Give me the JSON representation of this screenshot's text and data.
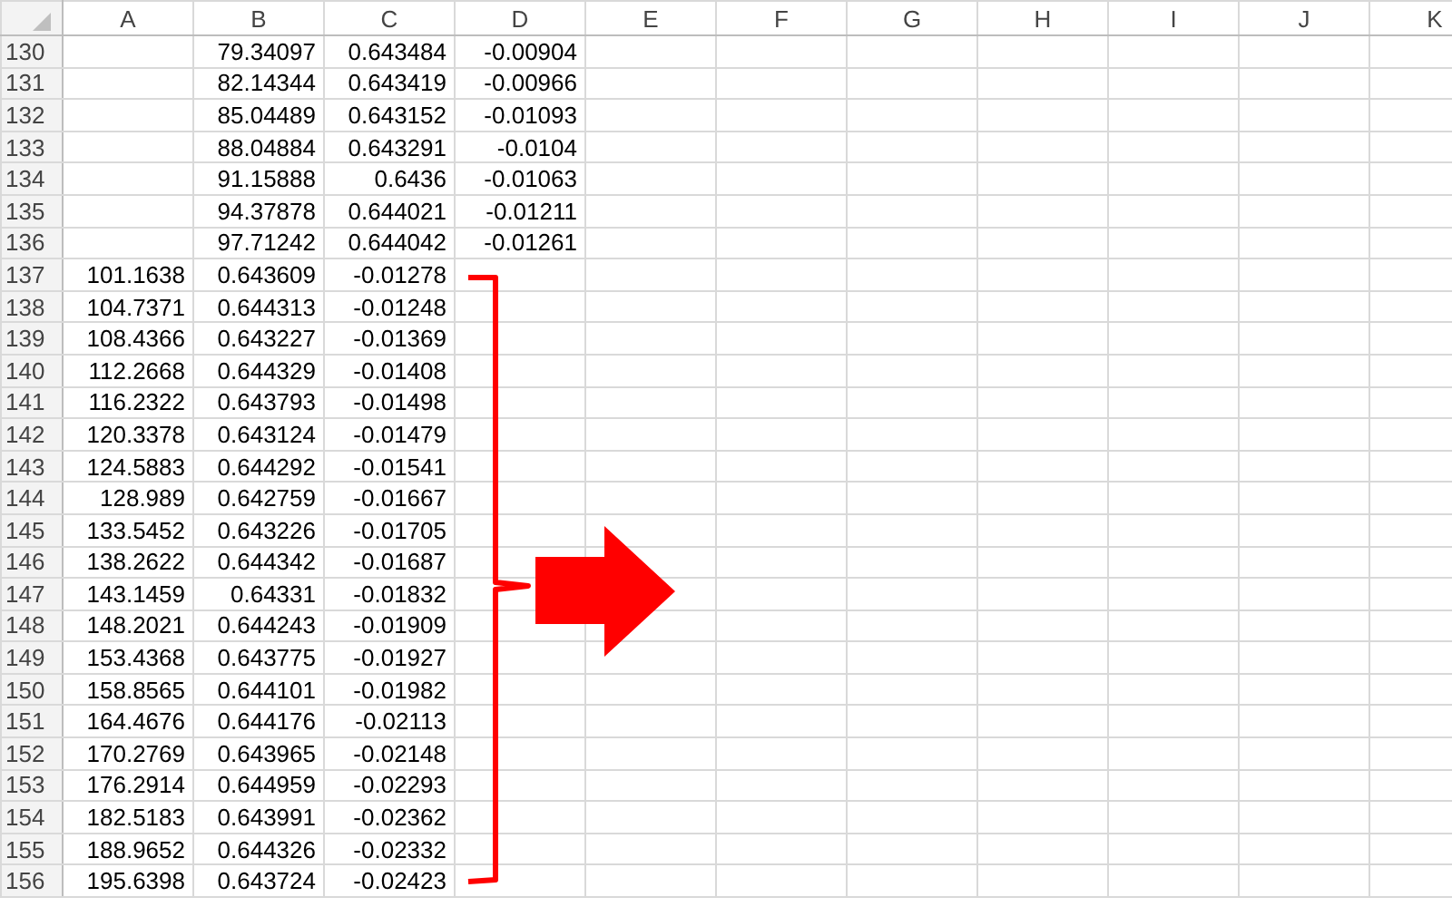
{
  "columns": [
    "A",
    "B",
    "C",
    "D",
    "E",
    "F",
    "G",
    "H",
    "I",
    "J",
    "K"
  ],
  "rows": [
    {
      "number": "130",
      "cells": [
        null,
        "79.34097",
        "0.643484",
        "-0.00904"
      ]
    },
    {
      "number": "131",
      "cells": [
        null,
        "82.14344",
        "0.643419",
        "-0.00966"
      ]
    },
    {
      "number": "132",
      "cells": [
        null,
        "85.04489",
        "0.643152",
        "-0.01093"
      ]
    },
    {
      "number": "133",
      "cells": [
        null,
        "88.04884",
        "0.643291",
        "-0.0104"
      ]
    },
    {
      "number": "134",
      "cells": [
        null,
        "91.15888",
        "0.6436",
        "-0.01063"
      ]
    },
    {
      "number": "135",
      "cells": [
        null,
        "94.37878",
        "0.644021",
        "-0.01211"
      ]
    },
    {
      "number": "136",
      "cells": [
        null,
        "97.71242",
        "0.644042",
        "-0.01261"
      ]
    },
    {
      "number": "137",
      "cells": [
        "101.1638",
        "0.643609",
        "-0.01278",
        null
      ]
    },
    {
      "number": "138",
      "cells": [
        "104.7371",
        "0.644313",
        "-0.01248",
        null
      ]
    },
    {
      "number": "139",
      "cells": [
        "108.4366",
        "0.643227",
        "-0.01369",
        null
      ]
    },
    {
      "number": "140",
      "cells": [
        "112.2668",
        "0.644329",
        "-0.01408",
        null
      ]
    },
    {
      "number": "141",
      "cells": [
        "116.2322",
        "0.643793",
        "-0.01498",
        null
      ]
    },
    {
      "number": "142",
      "cells": [
        "120.3378",
        "0.643124",
        "-0.01479",
        null
      ]
    },
    {
      "number": "143",
      "cells": [
        "124.5883",
        "0.644292",
        "-0.01541",
        null
      ]
    },
    {
      "number": "144",
      "cells": [
        "128.989",
        "0.642759",
        "-0.01667",
        null
      ]
    },
    {
      "number": "145",
      "cells": [
        "133.5452",
        "0.643226",
        "-0.01705",
        null
      ]
    },
    {
      "number": "146",
      "cells": [
        "138.2622",
        "0.644342",
        "-0.01687",
        null
      ]
    },
    {
      "number": "147",
      "cells": [
        "143.1459",
        "0.64331",
        "-0.01832",
        null
      ]
    },
    {
      "number": "148",
      "cells": [
        "148.2021",
        "0.644243",
        "-0.01909",
        null
      ]
    },
    {
      "number": "149",
      "cells": [
        "153.4368",
        "0.643775",
        "-0.01927",
        null
      ]
    },
    {
      "number": "150",
      "cells": [
        "158.8565",
        "0.644101",
        "-0.01982",
        null
      ]
    },
    {
      "number": "151",
      "cells": [
        "164.4676",
        "0.644176",
        "-0.02113",
        null
      ]
    },
    {
      "number": "152",
      "cells": [
        "170.2769",
        "0.643965",
        "-0.02148",
        null
      ]
    },
    {
      "number": "153",
      "cells": [
        "176.2914",
        "0.644959",
        "-0.02293",
        null
      ]
    },
    {
      "number": "154",
      "cells": [
        "182.5183",
        "0.643991",
        "-0.02362",
        null
      ]
    },
    {
      "number": "155",
      "cells": [
        "188.9652",
        "0.644326",
        "-0.02332",
        null
      ]
    },
    {
      "number": "156",
      "cells": [
        "195.6398",
        "0.643724",
        "-0.02423",
        null
      ]
    }
  ]
}
